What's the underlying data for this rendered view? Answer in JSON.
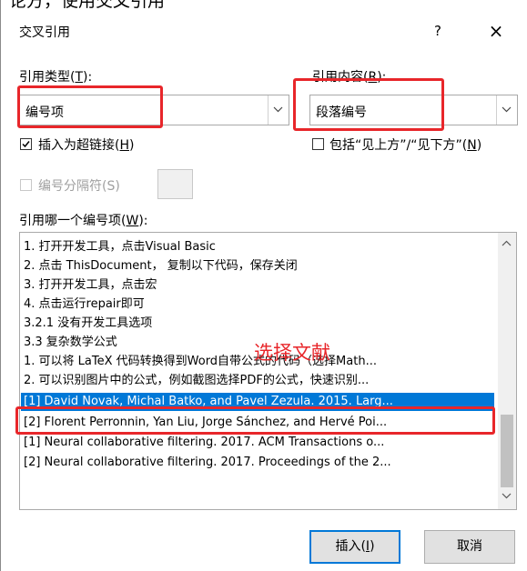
{
  "background_fragment": "论方，使用交叉引用",
  "dialog": {
    "title": "交叉引用",
    "help_glyph": "?",
    "close_glyph": "×"
  },
  "ref_type": {
    "label": "引用类型(",
    "access_key": "T",
    "label_end": "):",
    "value": "编号项"
  },
  "ref_content": {
    "label": "引用内容(",
    "access_key": "R",
    "label_end": "):",
    "value": "段落编号"
  },
  "insert_hyperlink": {
    "label": "插入为超链接(",
    "access_key": "H",
    "label_end": ")",
    "checked": true
  },
  "above_below": {
    "label": "包括“见上方”/“见下方”(",
    "access_key": "N",
    "label_end": ")",
    "checked": false
  },
  "separator": {
    "label": "编号分隔符(S)",
    "enabled": false
  },
  "list_label": {
    "label": "引用哪一个编号项(",
    "access_key": "W",
    "label_end": "):"
  },
  "items": [
    {
      "text": "1. 打开开发工具，点击Visual Basic"
    },
    {
      "text": "2. 点击 ThisDocument， 复制以下代码，保存关闭"
    },
    {
      "text": "3. 打开开发工具，点击宏"
    },
    {
      "text": "4. 点击运行repair即可"
    },
    {
      "text": "  3.2.1 没有开发工具选项"
    },
    {
      "text": " 3.3 复杂数学公式"
    },
    {
      "text": "1. 可以将 LaTeX 代码转换得到Word自带公式的代码（选择Math..."
    },
    {
      "text": "2. 可以识别图片中的公式，例如截图选择PDF的公式，快速识别..."
    },
    {
      "text": "[1] David Novak, Michal Batko, and Pavel Zezula. 2015. Larg...",
      "selected": true
    },
    {
      "text": "[2] Florent Perronnin, Yan Liu, Jorge Sánchez, and Hervé Poi..."
    },
    {
      "text": "[1] Neural collaborative filtering. 2017. ACM Transactions o..."
    },
    {
      "text": "[2] Neural collaborative filtering. 2017. Proceedings of the 2..."
    }
  ],
  "annotation": "选择文献",
  "buttons": {
    "insert_label": "插入(",
    "insert_key": "I",
    "insert_end": ")",
    "cancel_label": "取消"
  },
  "colors": {
    "selection": "#0078d7",
    "annotation": "#e8262a"
  }
}
